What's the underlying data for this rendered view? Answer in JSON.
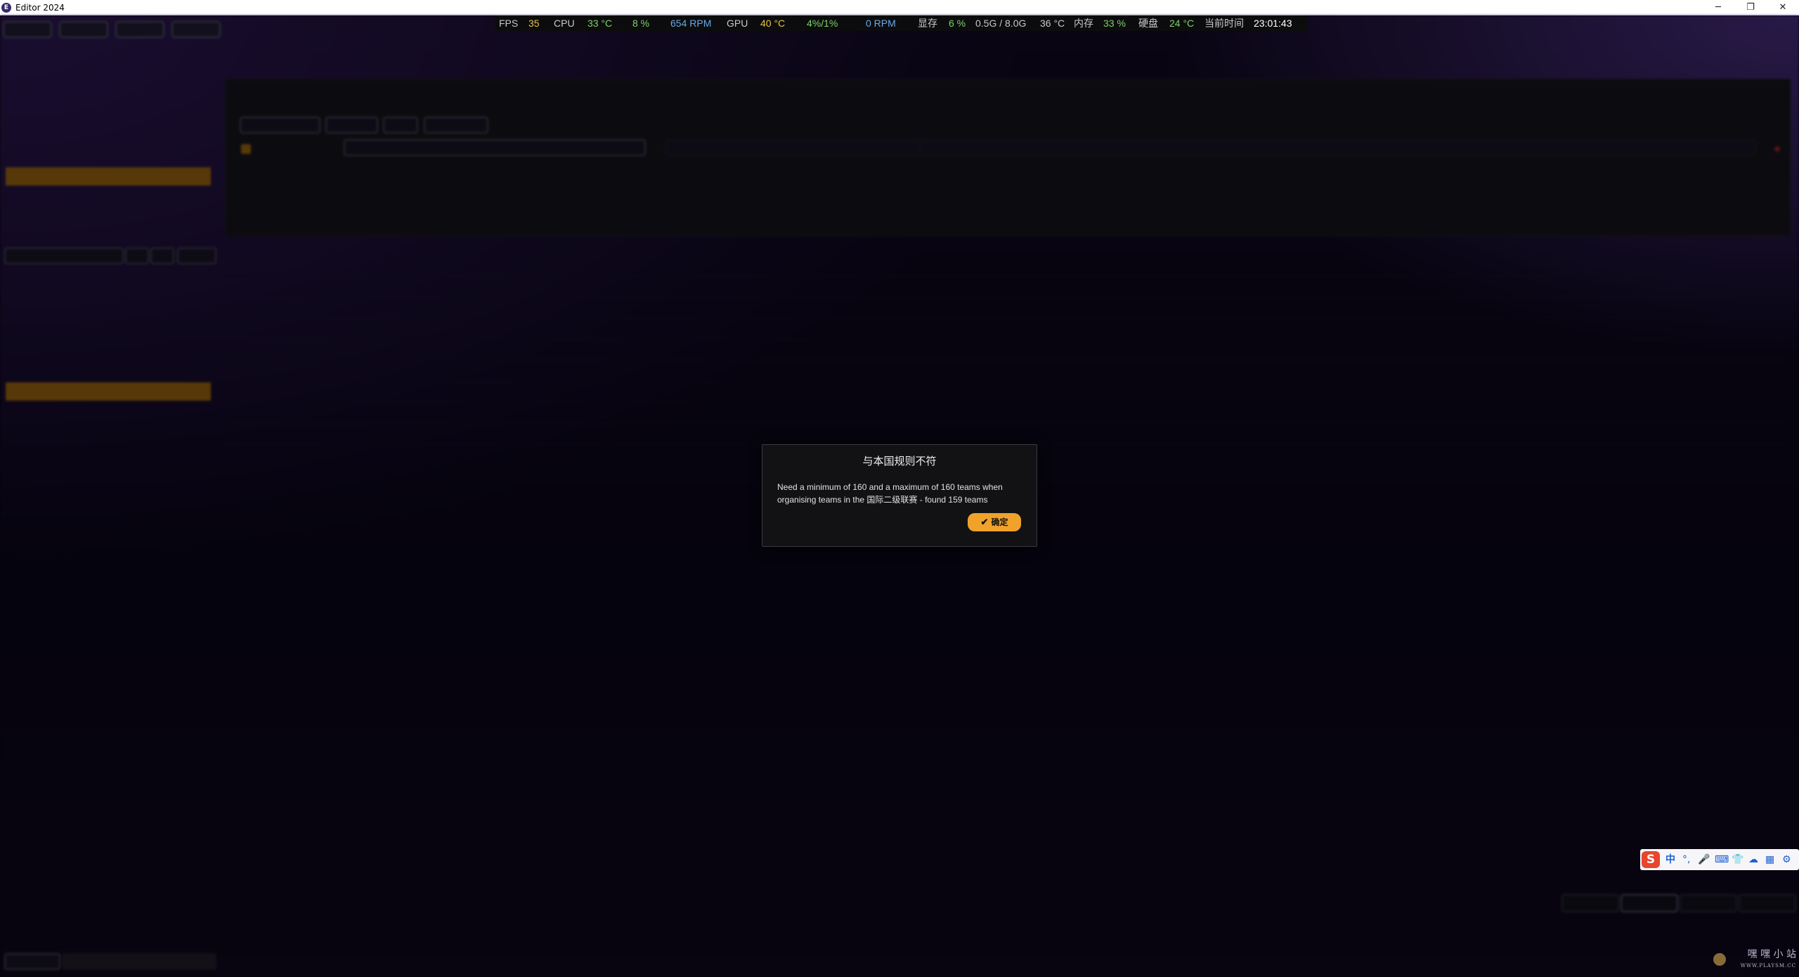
{
  "window": {
    "app_icon": "E",
    "title": "Editor 2024",
    "minimize_glyph": "─",
    "restore_glyph": "❐",
    "close_glyph": "✕"
  },
  "stats": {
    "fps_label": "FPS",
    "fps_value": "35",
    "cpu_label": "CPU",
    "cpu_temp": "33 °C",
    "cpu_load": "8 %",
    "fan_rpm": "654 RPM",
    "gpu_label": "GPU",
    "gpu_temp": "40 °C",
    "gpu_load": "4%/1%",
    "gpu_fan": "0 RPM",
    "vram_label": "显存",
    "vram_pct": "6 %",
    "vram_used": "0.5G / 8.0G",
    "vram_temp": "36 °C",
    "mem_label": "内存",
    "mem_pct": "33 %",
    "disk_label": "硬盘",
    "disk_temp": "24 °C",
    "time_label": "当前时间",
    "time_value": "23:01:43"
  },
  "modal": {
    "title": "与本国规则不符",
    "message": "Need a minimum of 160 and a maximum of 160 teams when organising teams in the 国际二级联赛 - found 159 teams",
    "ok_label": "确定",
    "ok_icon": "check-icon"
  },
  "ime": {
    "logo": "S",
    "items": [
      "中",
      "°,",
      "🎤",
      "⌨",
      "👕",
      "☁",
      "▦",
      "⚙"
    ]
  },
  "watermark": {
    "text": "嘿 嘿 小 站",
    "sub": "WWW.PLAYSM.CC"
  },
  "colors": {
    "accent": "#f0a22a",
    "stat_yellow": "#e6c24a",
    "stat_green": "#7ed26a",
    "stat_blue": "#6aa8e8",
    "stat_gray": "#c8c8c8"
  }
}
